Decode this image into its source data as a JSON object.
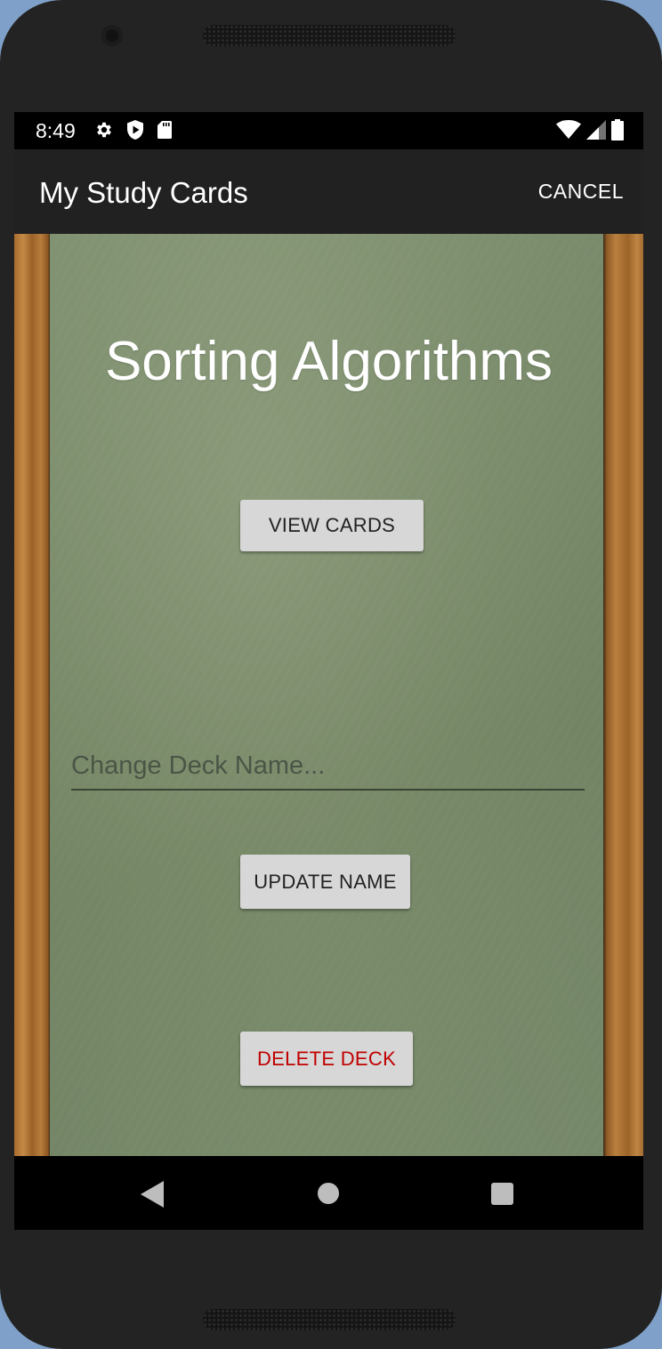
{
  "status_bar": {
    "time": "8:49",
    "left_icons": [
      "gear-icon",
      "shield-play-icon",
      "sd-card-icon"
    ],
    "right_icons": [
      "wifi-icon",
      "cell-signal-icon",
      "battery-icon"
    ]
  },
  "app_bar": {
    "title": "My Study Cards",
    "cancel_label": "CANCEL"
  },
  "deck": {
    "title": "Sorting Algorithms",
    "view_cards_label": "VIEW CARDS",
    "name_input_placeholder": "Change Deck Name...",
    "name_input_value": "",
    "update_name_label": "UPDATE NAME",
    "delete_deck_label": "DELETE DECK"
  },
  "colors": {
    "chalkboard": "#7b8d6b",
    "wood_frame": "#b07638",
    "delete_text": "#c00000",
    "app_bar": "#212121"
  },
  "nav_bar": {
    "buttons": [
      "back-icon",
      "home-icon",
      "recents-icon"
    ]
  }
}
